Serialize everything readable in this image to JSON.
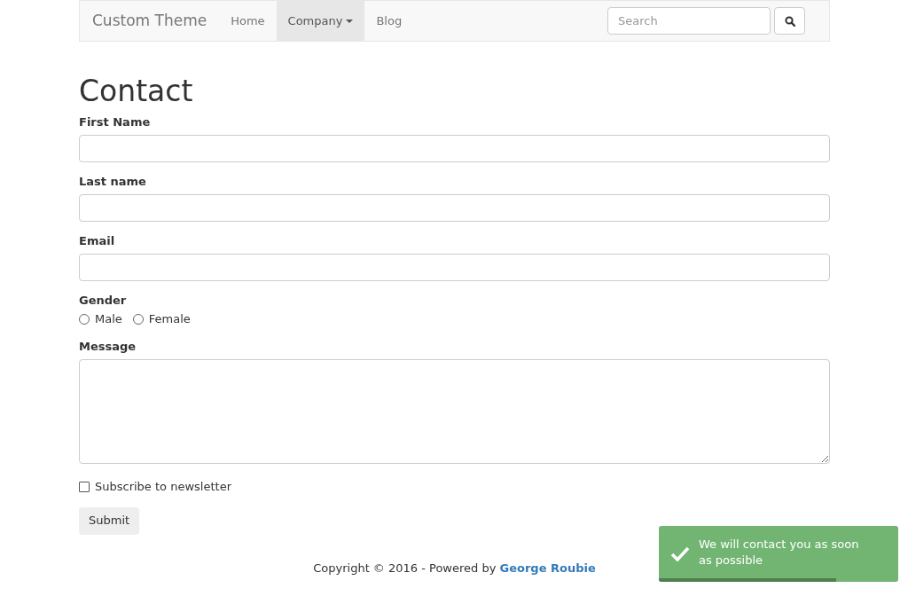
{
  "navbar": {
    "brand": "Custom Theme",
    "items": [
      {
        "label": "Home",
        "selected": false,
        "dropdown": false
      },
      {
        "label": "Company",
        "selected": true,
        "dropdown": true
      },
      {
        "label": "Blog",
        "selected": false,
        "dropdown": false
      }
    ],
    "search": {
      "placeholder": "Search"
    }
  },
  "page": {
    "title": "Contact"
  },
  "form": {
    "fields": [
      {
        "kind": "text",
        "label": "First Name"
      },
      {
        "kind": "text",
        "label": "Last name"
      },
      {
        "kind": "text",
        "label": "Email"
      },
      {
        "kind": "radio",
        "label": "Gender",
        "options": [
          {
            "label": "Male",
            "selected": false
          },
          {
            "label": "Female",
            "selected": false
          }
        ]
      },
      {
        "kind": "textarea",
        "label": "Message"
      },
      {
        "kind": "checkbox",
        "label": "Subscribe to newsletter",
        "checked": false
      }
    ],
    "submit": "Submit"
  },
  "footer": {
    "text": "Copyright © 2016 - Powered by",
    "link": "George Roubie"
  },
  "toast": {
    "message": "We will contact you as soon as possible",
    "level": 0.74
  }
}
